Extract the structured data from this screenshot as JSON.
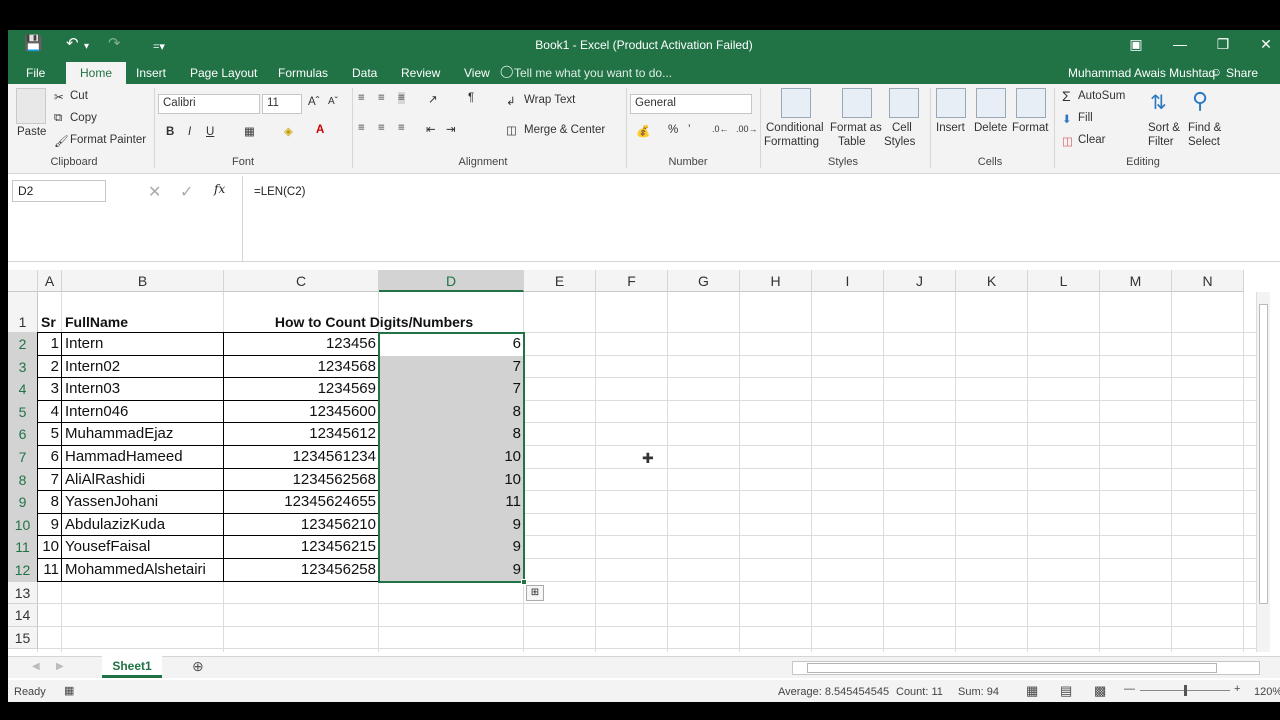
{
  "window_title": "Book1 - Excel (Product Activation Failed)",
  "qat": {
    "save_icon": "save-icon",
    "undo_icon": "undo-icon",
    "redo_icon": "redo-icon"
  },
  "tabs": [
    "File",
    "Home",
    "Insert",
    "Page Layout",
    "Formulas",
    "Data",
    "Review",
    "View"
  ],
  "tell_me": "Tell me what you want to do...",
  "user_name": "Muhammad Awais Mushtaq",
  "share_label": "Share",
  "ribbon": {
    "clipboard": {
      "paste": "Paste",
      "cut": "Cut",
      "copy": "Copy",
      "format_painter": "Format Painter",
      "label": "Clipboard"
    },
    "font": {
      "name": "Calibri",
      "size": "11",
      "label": "Font",
      "bold": "B",
      "italic": "I",
      "underline": "U"
    },
    "alignment": {
      "wrap": "Wrap Text",
      "merge": "Merge & Center",
      "label": "Alignment"
    },
    "number": {
      "format": "General",
      "label": "Number",
      "percent": "%"
    },
    "styles": {
      "conditional": "Conditional",
      "conditional2": "Formatting",
      "format_as": "Format as",
      "format_as2": "Table",
      "cell": "Cell",
      "cell2": "Styles",
      "label": "Styles"
    },
    "cells": {
      "insert": "Insert",
      "delete": "Delete",
      "format": "Format",
      "label": "Cells"
    },
    "editing": {
      "autosum": "AutoSum",
      "fill": "Fill",
      "clear": "Clear",
      "sort": "Sort &",
      "sort2": "Filter",
      "find": "Find &",
      "find2": "Select",
      "label": "Editing"
    }
  },
  "name_box": "D2",
  "formula": "=LEN(C2)",
  "columns": [
    "A",
    "B",
    "C",
    "D",
    "E",
    "F",
    "G",
    "H",
    "I",
    "J",
    "K",
    "L",
    "M",
    "N"
  ],
  "rows": [
    "1",
    "2",
    "3",
    "4",
    "5",
    "6",
    "7",
    "8",
    "9",
    "10",
    "11",
    "12",
    "13",
    "14",
    "15"
  ],
  "header": {
    "a": "Sr",
    "b": "FullName",
    "c": "How to Count Digits/Numbers"
  },
  "data_rows": [
    {
      "sr": "1",
      "name": "Intern",
      "value": "123456",
      "len": "6"
    },
    {
      "sr": "2",
      "name": "Intern02",
      "value": "1234568",
      "len": "7"
    },
    {
      "sr": "3",
      "name": "Intern03",
      "value": "1234569",
      "len": "7"
    },
    {
      "sr": "4",
      "name": "Intern046",
      "value": "12345600",
      "len": "8"
    },
    {
      "sr": "5",
      "name": "MuhammadEjaz",
      "value": "12345612",
      "len": "8"
    },
    {
      "sr": "6",
      "name": "HammadHameed",
      "value": "1234561234",
      "len": "10"
    },
    {
      "sr": "7",
      "name": "AliAlRashidi",
      "value": "1234562568",
      "len": "10"
    },
    {
      "sr": "8",
      "name": "YassenJohani",
      "value": "12345624655",
      "len": "11"
    },
    {
      "sr": "9",
      "name": "AbdulazizKuda",
      "value": "123456210",
      "len": "9"
    },
    {
      "sr": "10",
      "name": "YousefFaisal",
      "value": "123456215",
      "len": "9"
    },
    {
      "sr": "11",
      "name": "MohammedAlshetairi",
      "value": "123456258",
      "len": "9"
    }
  ],
  "sheet_tab": "Sheet1",
  "status": {
    "ready": "Ready",
    "average": "Average: 8.545454545",
    "count": "Count: 11",
    "sum": "Sum: 94",
    "zoom": "120%"
  }
}
